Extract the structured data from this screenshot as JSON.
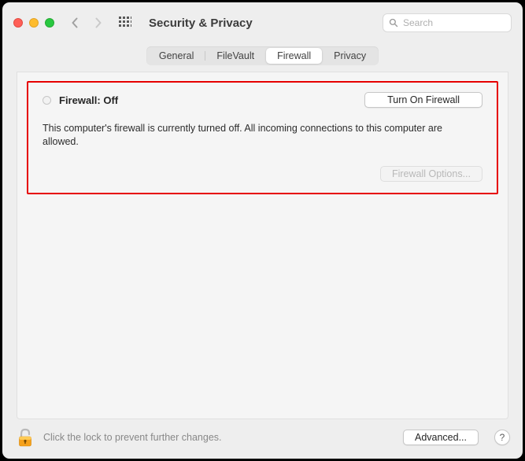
{
  "window": {
    "title": "Security & Privacy"
  },
  "search": {
    "placeholder": "Search"
  },
  "tabs": {
    "general": "General",
    "filevault": "FileVault",
    "firewall": "Firewall",
    "privacy": "Privacy",
    "active": "firewall"
  },
  "firewall": {
    "status_label": "Firewall: Off",
    "turn_on_label": "Turn On Firewall",
    "description": "This computer's firewall is currently turned off. All incoming connections to this computer are allowed.",
    "options_label": "Firewall Options..."
  },
  "footer": {
    "lock_text": "Click the lock to prevent further changes.",
    "advanced_label": "Advanced...",
    "help_label": "?"
  }
}
